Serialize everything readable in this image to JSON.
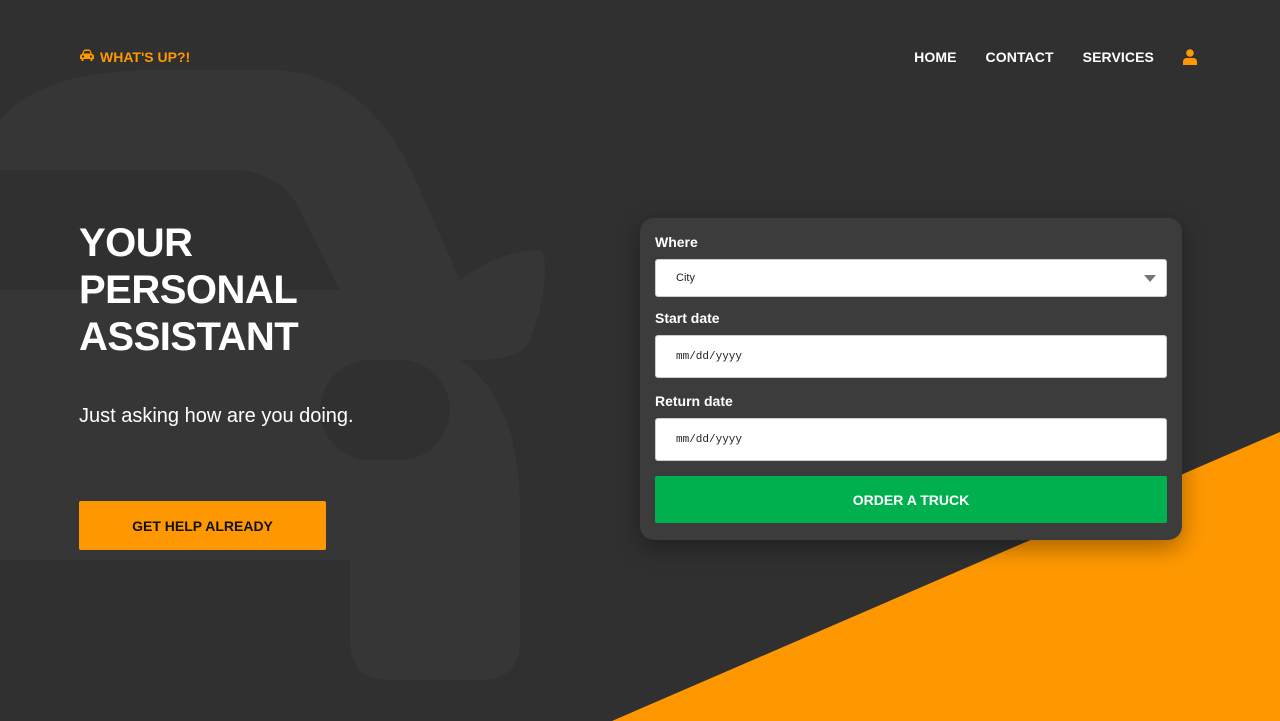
{
  "brand": {
    "name": "WHAT'S UP?!",
    "icon": "car-icon",
    "color": "#ff9800"
  },
  "nav": {
    "items": [
      "HOME",
      "CONTACT",
      "SERVICES"
    ],
    "user_icon": "user-icon"
  },
  "hero": {
    "title_lines": [
      "YOUR",
      "PERSONAL",
      "ASSISTANT"
    ],
    "subtitle": "Just asking how are you doing.",
    "cta_label": "GET HELP ALREADY"
  },
  "form": {
    "where_label": "Where",
    "where_value": "City",
    "start_label": "Start date",
    "start_value": "mm/dd/yyyy",
    "return_label": "Return date",
    "return_value": "mm/dd/yyyy",
    "submit_label": "ORDER A TRUCK"
  },
  "colors": {
    "accent": "#ff9800",
    "background": "#303030",
    "card": "#3c3c3c",
    "submit": "#00b04f"
  }
}
